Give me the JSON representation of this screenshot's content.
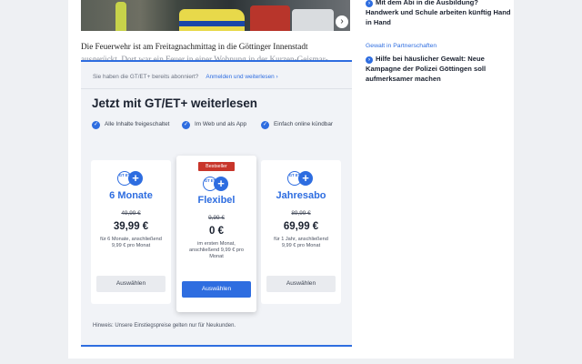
{
  "article": {
    "photo_button": "›",
    "line1": "Die Feuerwehr ist am Freitagnachmittag in die Göttinger Innenstadt",
    "line2": "ausgerückt. Dort war ein Feuer in einer Wohnung in der Kurzen-Geismar-"
  },
  "paywall": {
    "already_subscribed": "Sie haben die GT/ET+ bereits abonniert?",
    "login_link": "Anmelden und weiterlesen  ›",
    "headline": "Jetzt mit GT/ET+ weiterlesen",
    "features": [
      {
        "text": "Alle Inhalte freigeschaltet"
      },
      {
        "text": "Im Web und als App"
      },
      {
        "text": "Einfach online kündbar"
      }
    ],
    "plans": [
      {
        "name": "6 Monate",
        "old_price": "49,99 €",
        "price": "39,99 €",
        "desc": "für 6 Monate, anschließend 9,99 € pro Monat",
        "button": "Auswählen"
      },
      {
        "badge": "Bestseller",
        "name": "Flexibel",
        "old_price": "9,99 €",
        "price": "0 €",
        "desc": "im ersten Monat, anschließend 9,99 € pro Monat",
        "button": "Auswählen"
      },
      {
        "name": "Jahresabo",
        "old_price": "89,99 €",
        "price": "69,99 €",
        "desc": "für 1 Jahr, anschließend 9,99 € pro Monat",
        "button": "Auswählen"
      }
    ],
    "logo_text": "GT ET",
    "hint": "Hinweis: Unsere Einstiegspreise gelten nur für Neukunden."
  },
  "sidebar": {
    "arrow": "›",
    "item1": "Mit dem Abi in die Ausbildung? Handwerk und Schule arbeiten künftig Hand in Hand",
    "category": "Gewalt in Partnerschaften",
    "item2": "Hilfe bei häuslicher Gewalt: Neue Kampagne der Polizei Göttingen soll aufmerksamer machen"
  },
  "colors": {
    "accent": "#2e6de0",
    "badge": "#c8352a"
  }
}
